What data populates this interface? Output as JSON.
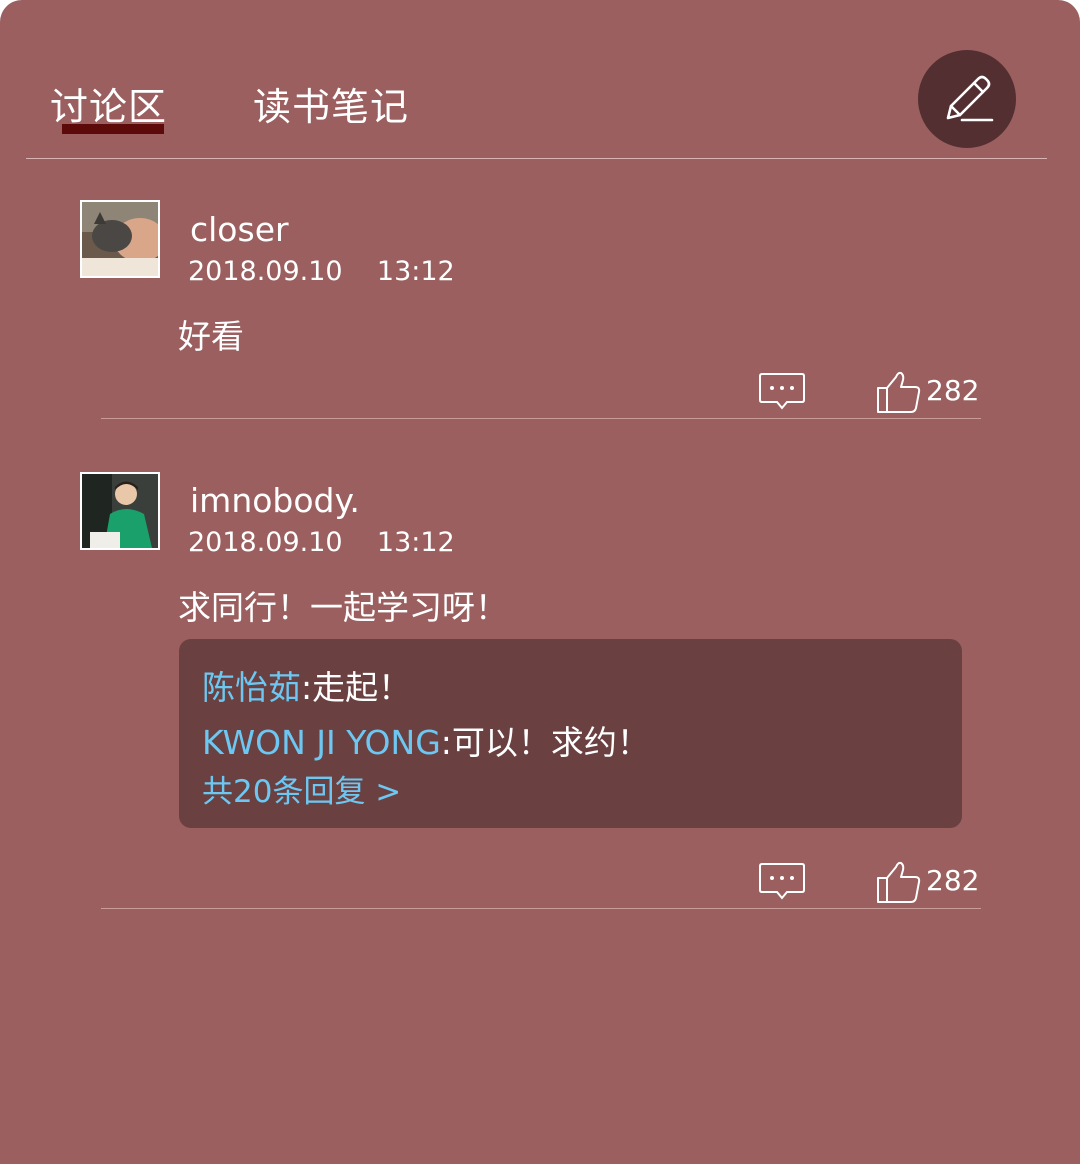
{
  "tabs": [
    {
      "label": "讨论区",
      "active": true
    },
    {
      "label": "读书笔记",
      "active": false
    }
  ],
  "edit_button": {
    "icon": "pencil-icon"
  },
  "colors": {
    "background": "#9a5f5e",
    "active_underline": "#5c0a0a",
    "edit_button_bg": "#532f31",
    "reply_box_bg": "#6a4041",
    "reply_author": "#6cc8f2"
  },
  "comments": [
    {
      "username": "closer",
      "date": "2018.09.10",
      "time": "13:12",
      "datetime": "2018.09.10    13:12",
      "text": "好看",
      "likes": "282",
      "replies": []
    },
    {
      "username": "imnobody.",
      "date": "2018.09.10",
      "time": "13:12",
      "datetime": "2018.09.10    13:12",
      "text": "求同行！一起学习呀！",
      "likes": "282",
      "replies": [
        {
          "author": "陈怡茹",
          "text": ":走起！"
        },
        {
          "author": "KWON JI YONG",
          "text": ":可以！求约！"
        }
      ],
      "more_replies_label": "共20条回复 >"
    }
  ]
}
